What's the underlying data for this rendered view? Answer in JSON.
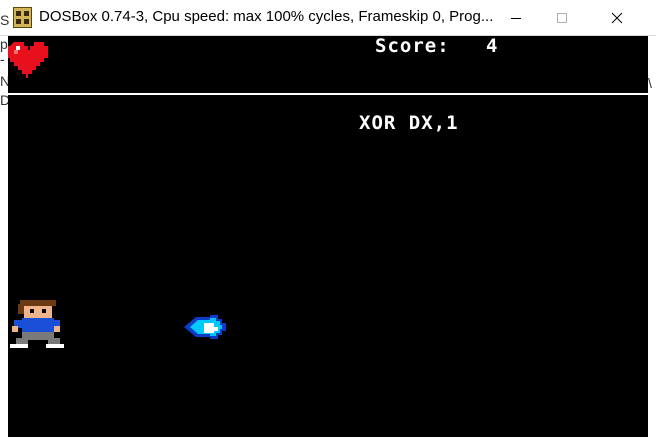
{
  "window": {
    "title": "DOSBox 0.74-3, Cpu speed: max 100% cycles, Frameskip  0, Prog...",
    "icon": "dosbox-icon",
    "buttons": [
      "minimize-icon",
      "maximize-icon",
      "close-icon"
    ]
  },
  "side_text": {
    "left_chars": [
      "S",
      "p",
      "-",
      "N",
      "D"
    ],
    "right_char": "\\"
  },
  "game": {
    "score_label": "Score:",
    "score_value": "4",
    "instruction": "XOR DX,1",
    "lives_icon": "heart-icon",
    "lives": 1,
    "sprites": [
      "player-sprite",
      "fireball-sprite"
    ]
  },
  "colors": {
    "background": "#000000",
    "text": "#ffffff",
    "heart": "#e8101c",
    "fireball": "#00c8ff"
  }
}
